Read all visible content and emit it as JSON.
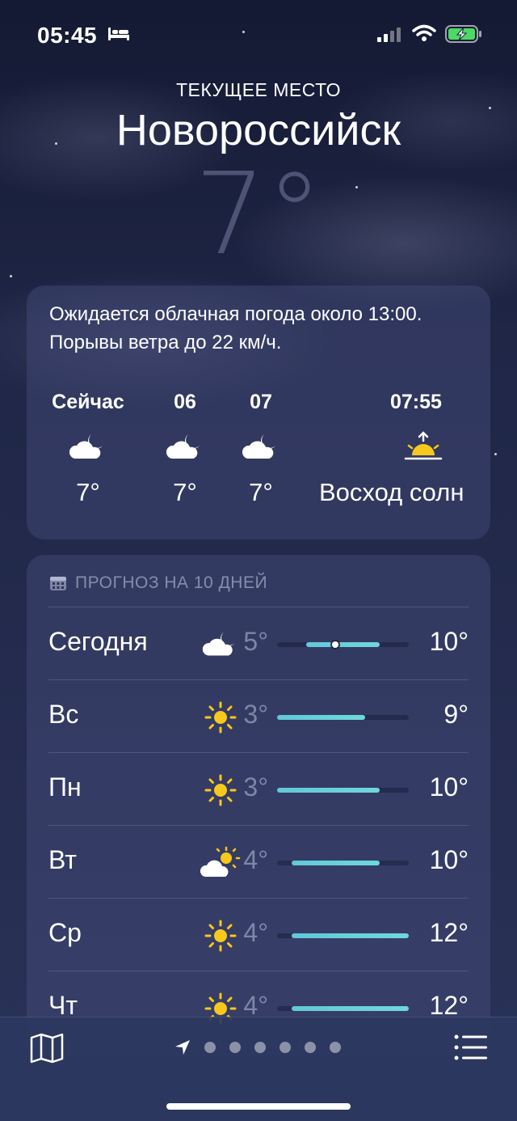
{
  "status_bar": {
    "time": "05:45"
  },
  "header": {
    "location_label": "ТЕКУЩЕЕ МЕСТО",
    "city": "Новороссийск",
    "temperature": "7°"
  },
  "hourly": {
    "summary": "Ожидается облачная погода около 13:00. Порывы ветра до 22 км/ч.",
    "items": [
      {
        "label": "Сейчас",
        "icon": "partly-cloudy-night-icon",
        "temp": "7°"
      },
      {
        "label": "06",
        "icon": "partly-cloudy-night-icon",
        "temp": "7°"
      },
      {
        "label": "07",
        "icon": "partly-cloudy-night-icon",
        "temp": "7°"
      }
    ],
    "sunrise": {
      "label": "07:55",
      "icon": "sunrise-icon",
      "text": "Восход солн"
    }
  },
  "daily": {
    "title": "ПРОГНОЗ НА 10 ДНЕЙ",
    "range_min": 3,
    "range_max": 12,
    "current_temp": 7,
    "days": [
      {
        "day": "Сегодня",
        "icon": "partly-cloudy-night-icon",
        "low": "5°",
        "high": "10°",
        "low_value": 5,
        "high_value": 10
      },
      {
        "day": "Вс",
        "icon": "sun-icon",
        "low": "3°",
        "high": "9°",
        "low_value": 3,
        "high_value": 9
      },
      {
        "day": "Пн",
        "icon": "sun-icon",
        "low": "3°",
        "high": "10°",
        "low_value": 3,
        "high_value": 10
      },
      {
        "day": "Вт",
        "icon": "partly-sunny-icon",
        "low": "4°",
        "high": "10°",
        "low_value": 4,
        "high_value": 10
      },
      {
        "day": "Ср",
        "icon": "sun-icon",
        "low": "4°",
        "high": "12°",
        "low_value": 4,
        "high_value": 12
      },
      {
        "day": "Чт",
        "icon": "sun-icon",
        "low": "4°",
        "high": "12°",
        "low_value": 4,
        "high_value": 12
      }
    ]
  },
  "colors": {
    "accent_bar": "#61c8d8",
    "sun": "#f7c81c"
  }
}
